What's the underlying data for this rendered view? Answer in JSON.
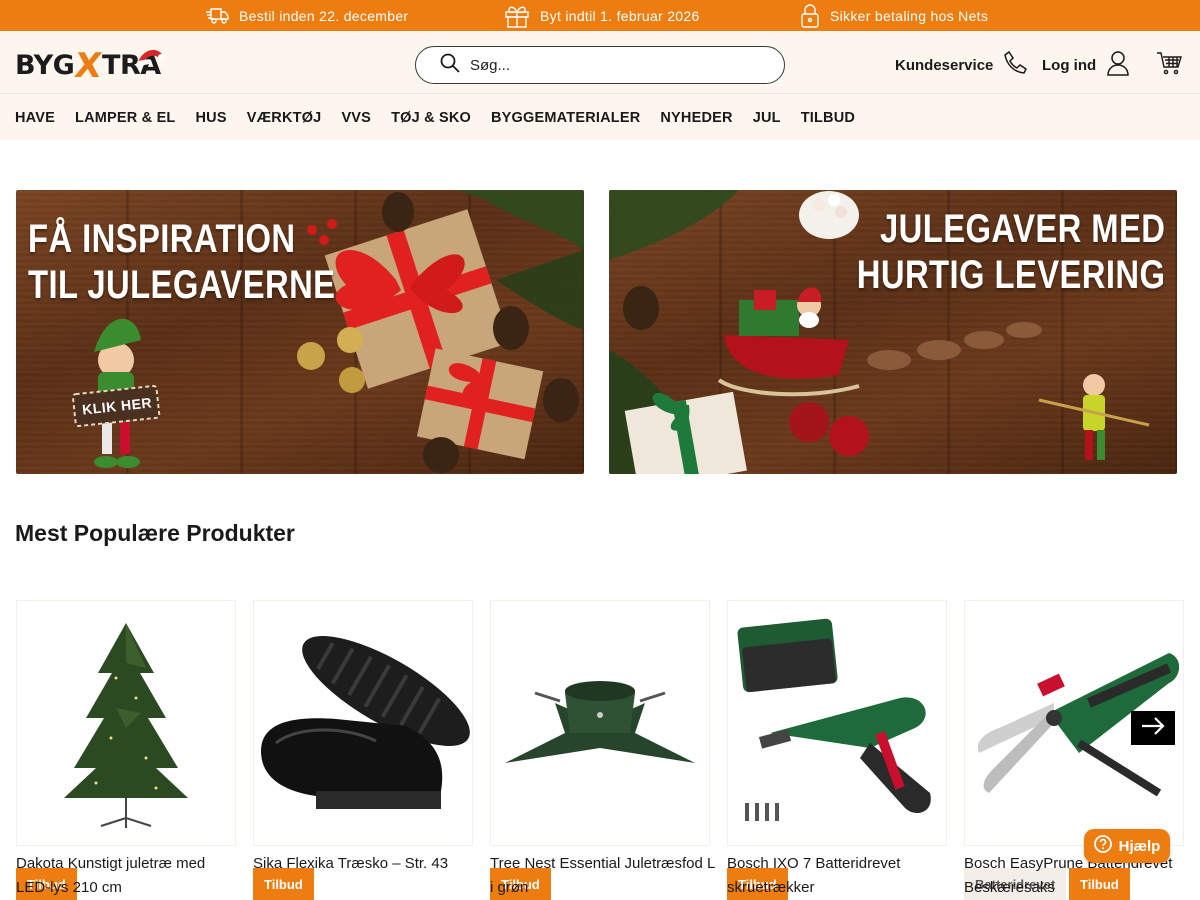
{
  "colors": {
    "accent": "#ee7d11",
    "header_bg": "#fdf6ef",
    "text": "#1a1a1a"
  },
  "promo": [
    {
      "icon": "delivery-truck-icon",
      "text": "Bestil inden 22. december"
    },
    {
      "icon": "gift-icon",
      "text": "Byt indtil 1. februar 2026"
    },
    {
      "icon": "lock-icon",
      "text": "Sikker betaling hos Nets"
    }
  ],
  "header": {
    "logo": {
      "part1": "BYG",
      "part2": "X",
      "part3": "TRA"
    },
    "search_placeholder": "Søg...",
    "customer_service": "Kundeservice",
    "login": "Log ind"
  },
  "nav": [
    "HAVE",
    "LAMPER & EL",
    "HUS",
    "VÆRKTØJ",
    "VVS",
    "TØJ & SKO",
    "BYGGEMATERIALER",
    "NYHEDER",
    "JUL",
    "TILBUD"
  ],
  "banners": [
    {
      "line1": "FÅ INSPIRATION",
      "line2": "TIL JULEGAVERNE",
      "cta": "KLIK HER"
    },
    {
      "line1": "JULEGAVER MED",
      "line2": "HURTIG LEVERING"
    }
  ],
  "section_title": "Mest Populære Produkter",
  "products": [
    {
      "name": "Dakota Kunstigt juletræ med LED-lys 210 cm",
      "badges": [
        "Tilbud"
      ]
    },
    {
      "name": "Sika Flexika Træsko – Str. 43",
      "badges": [
        "Tilbud"
      ]
    },
    {
      "name": "Tree Nest Essential Juletræsfod L i grøn",
      "badges": [
        "Tilbud"
      ]
    },
    {
      "name": "Bosch IXO 7 Batteridrevet skruetrækker",
      "badges": [
        "Tilbud"
      ]
    },
    {
      "name": "Bosch EasyPrune Batteridrevet Beskæresaks",
      "badges": [
        "Batteridrevet",
        "Tilbud"
      ]
    }
  ],
  "help_label": "Hjælp"
}
